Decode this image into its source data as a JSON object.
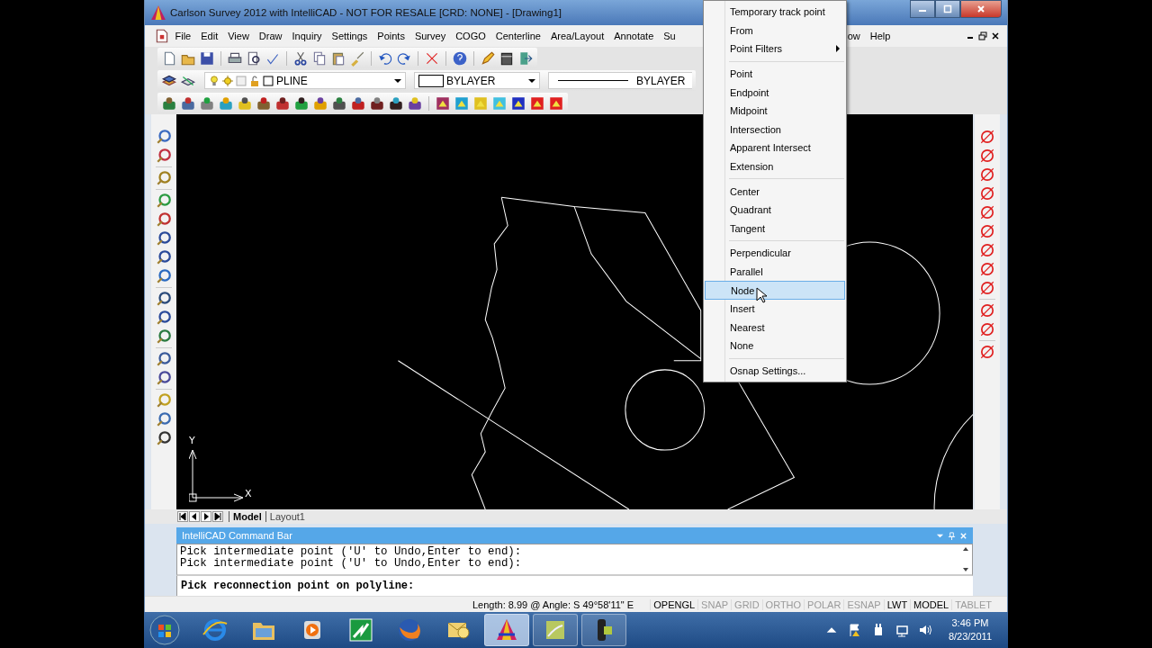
{
  "window": {
    "title": "Carlson Survey 2012 with IntelliCAD - NOT FOR RESALE [CRD: NONE] - [Drawing1]"
  },
  "menu_bar": [
    {
      "label": "File"
    },
    {
      "label": "Edit"
    },
    {
      "label": "View"
    },
    {
      "label": "Draw"
    },
    {
      "label": "Inquiry"
    },
    {
      "label": "Settings"
    },
    {
      "label": "Points"
    },
    {
      "label": "Survey"
    },
    {
      "label": "COGO"
    },
    {
      "label": "Centerline"
    },
    {
      "label": "Area/Layout"
    },
    {
      "label": "Annotate"
    },
    {
      "label": "Su"
    },
    {
      "label": "ow"
    },
    {
      "label": "Help"
    }
  ],
  "properties_bar": {
    "layer": "PLINE",
    "color_setting": "BYLAYER",
    "linetype": "BYLAYER"
  },
  "canvas": {
    "axis_y": "Y",
    "axis_x": "X"
  },
  "layout_tabs": [
    {
      "label": "Model",
      "selected": true
    },
    {
      "label": "Layout1",
      "selected": false
    }
  ],
  "command_bar": {
    "title": "IntelliCAD Command Bar",
    "history": [
      "Pick intermediate point ('U' to Undo,Enter to end):",
      "Pick intermediate point ('U' to Undo,Enter to end):"
    ],
    "prompt": "Pick reconnection point on polyline:"
  },
  "status_bar": {
    "text": "Length: 8.99 @ Angle: S 49°58'11\" E",
    "toggles": [
      {
        "label": "OPENGL",
        "on": true
      },
      {
        "label": "SNAP",
        "on": false
      },
      {
        "label": "GRID",
        "on": false
      },
      {
        "label": "ORTHO",
        "on": false
      },
      {
        "label": "POLAR",
        "on": false
      },
      {
        "label": "ESNAP",
        "on": false
      },
      {
        "label": "LWT",
        "on": true
      },
      {
        "label": "MODEL",
        "on": true
      },
      {
        "label": "TABLET",
        "on": false
      }
    ]
  },
  "osnap_menu": [
    {
      "kind": "item",
      "label": "Temporary track point",
      "selected": false,
      "submenu": false
    },
    {
      "kind": "item",
      "label": "From",
      "selected": false,
      "submenu": false
    },
    {
      "kind": "item",
      "label": "Point Filters",
      "selected": false,
      "submenu": true
    },
    {
      "kind": "separator"
    },
    {
      "kind": "item",
      "label": "Point",
      "selected": false,
      "submenu": false
    },
    {
      "kind": "item",
      "label": "Endpoint",
      "selected": false,
      "submenu": false
    },
    {
      "kind": "item",
      "label": "Midpoint",
      "selected": false,
      "submenu": false
    },
    {
      "kind": "item",
      "label": "Intersection",
      "selected": false,
      "submenu": false
    },
    {
      "kind": "item",
      "label": "Apparent Intersect",
      "selected": false,
      "submenu": false
    },
    {
      "kind": "item",
      "label": "Extension",
      "selected": false,
      "submenu": false
    },
    {
      "kind": "separator"
    },
    {
      "kind": "item",
      "label": "Center",
      "selected": false,
      "submenu": false
    },
    {
      "kind": "item",
      "label": "Quadrant",
      "selected": false,
      "submenu": false
    },
    {
      "kind": "item",
      "label": "Tangent",
      "selected": false,
      "submenu": false
    },
    {
      "kind": "separator"
    },
    {
      "kind": "item",
      "label": "Perpendicular",
      "selected": false,
      "submenu": false
    },
    {
      "kind": "item",
      "label": "Parallel",
      "selected": false,
      "submenu": false
    },
    {
      "kind": "item",
      "label": "Node",
      "selected": true,
      "submenu": false
    },
    {
      "kind": "item",
      "label": "Insert",
      "selected": false,
      "submenu": false
    },
    {
      "kind": "item",
      "label": "Nearest",
      "selected": false,
      "submenu": false
    },
    {
      "kind": "item",
      "label": "None",
      "selected": false,
      "submenu": false
    },
    {
      "kind": "separator"
    },
    {
      "kind": "item",
      "label": "Osnap Settings...",
      "selected": false,
      "submenu": false
    }
  ],
  "taskbar": {
    "apps": [
      {
        "kind": "browser",
        "running": false,
        "selected": false
      },
      {
        "kind": "folder",
        "running": false,
        "selected": false
      },
      {
        "kind": "media",
        "running": false,
        "selected": false
      },
      {
        "kind": "chart",
        "running": false,
        "selected": false
      },
      {
        "kind": "firefox",
        "running": false,
        "selected": false
      },
      {
        "kind": "mail",
        "running": false,
        "selected": false
      },
      {
        "kind": "cad",
        "running": true,
        "selected": true
      },
      {
        "kind": "notes",
        "running": true,
        "selected": false
      },
      {
        "kind": "camera",
        "running": true,
        "selected": false
      }
    ],
    "time": "3:46 PM",
    "date": "8/23/2011"
  }
}
